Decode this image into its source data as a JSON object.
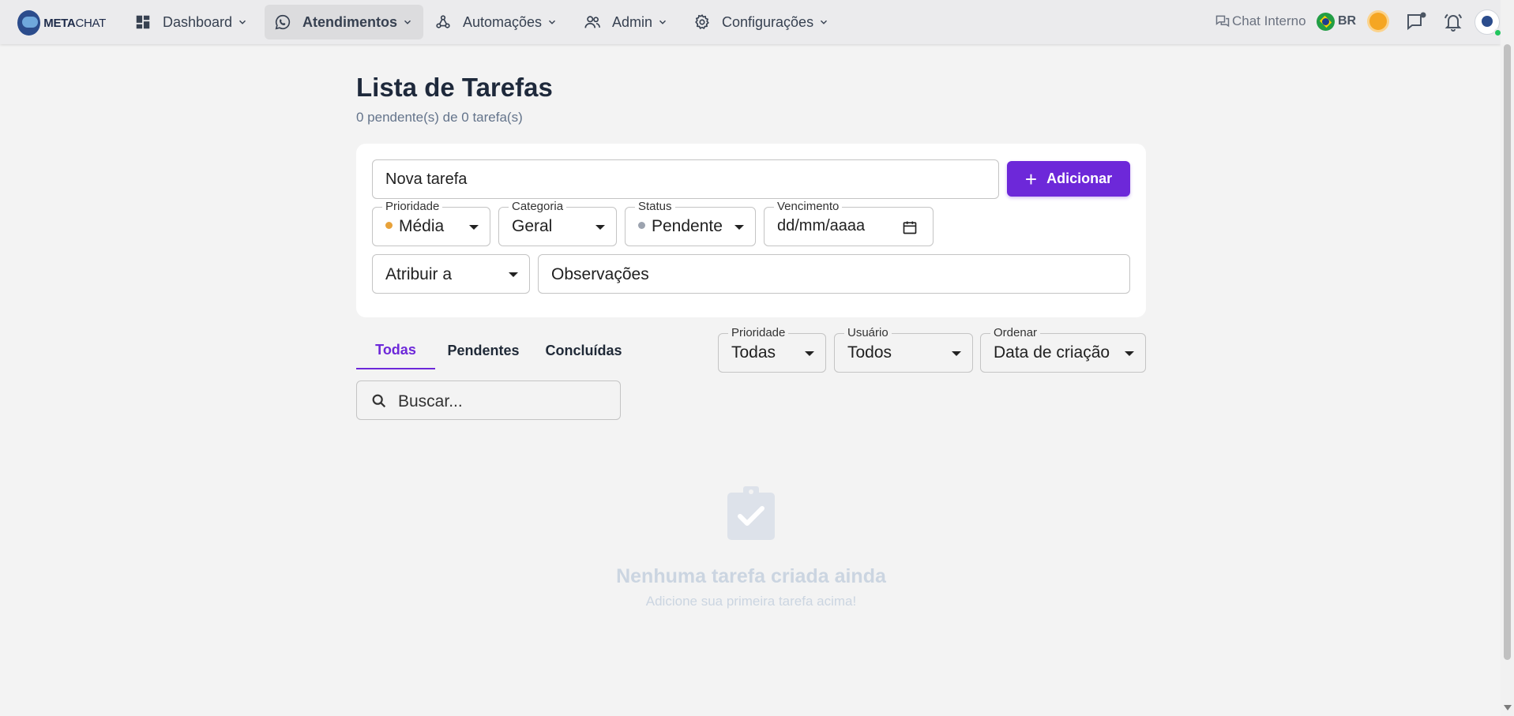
{
  "brand": {
    "name_bold": "META",
    "name_light": "CHAT"
  },
  "nav": {
    "items": [
      {
        "label": "Dashboard",
        "icon": "dashboard-icon"
      },
      {
        "label": "Atendimentos",
        "icon": "whatsapp-icon",
        "active": true
      },
      {
        "label": "Automações",
        "icon": "webhook-icon"
      },
      {
        "label": "Admin",
        "icon": "users-icon"
      },
      {
        "label": "Configurações",
        "icon": "gear-icon"
      }
    ]
  },
  "header_tools": {
    "chat_interno": "Chat Interno",
    "language": "BR"
  },
  "page": {
    "title": "Lista de Tarefas",
    "subtitle": "0 pendente(s) de 0 tarefa(s)"
  },
  "form": {
    "task_input_value": "Nova tarefa",
    "add_button": "Adicionar",
    "priority": {
      "label": "Prioridade",
      "value": "Média",
      "dot_color": "#e8a23a"
    },
    "category": {
      "label": "Categoria",
      "value": "Geral"
    },
    "status": {
      "label": "Status",
      "value": "Pendente",
      "dot_color": "#9ca3af"
    },
    "due": {
      "label": "Vencimento",
      "value": "dd/mm/aaaa"
    },
    "assign": {
      "value": "Atribuir a"
    },
    "notes": {
      "value": "Observações"
    }
  },
  "tabs": [
    {
      "label": "Todas",
      "active": true
    },
    {
      "label": "Pendentes"
    },
    {
      "label": "Concluídas"
    }
  ],
  "filters": {
    "priority": {
      "label": "Prioridade",
      "value": "Todas"
    },
    "user": {
      "label": "Usuário",
      "value": "Todos"
    },
    "order": {
      "label": "Ordenar",
      "value": "Data de criação"
    }
  },
  "search": {
    "placeholder": "Buscar..."
  },
  "empty": {
    "title": "Nenhuma tarefa criada ainda",
    "subtitle": "Adicione sua primeira tarefa acima!"
  },
  "colors": {
    "accent": "#6d28d9"
  }
}
